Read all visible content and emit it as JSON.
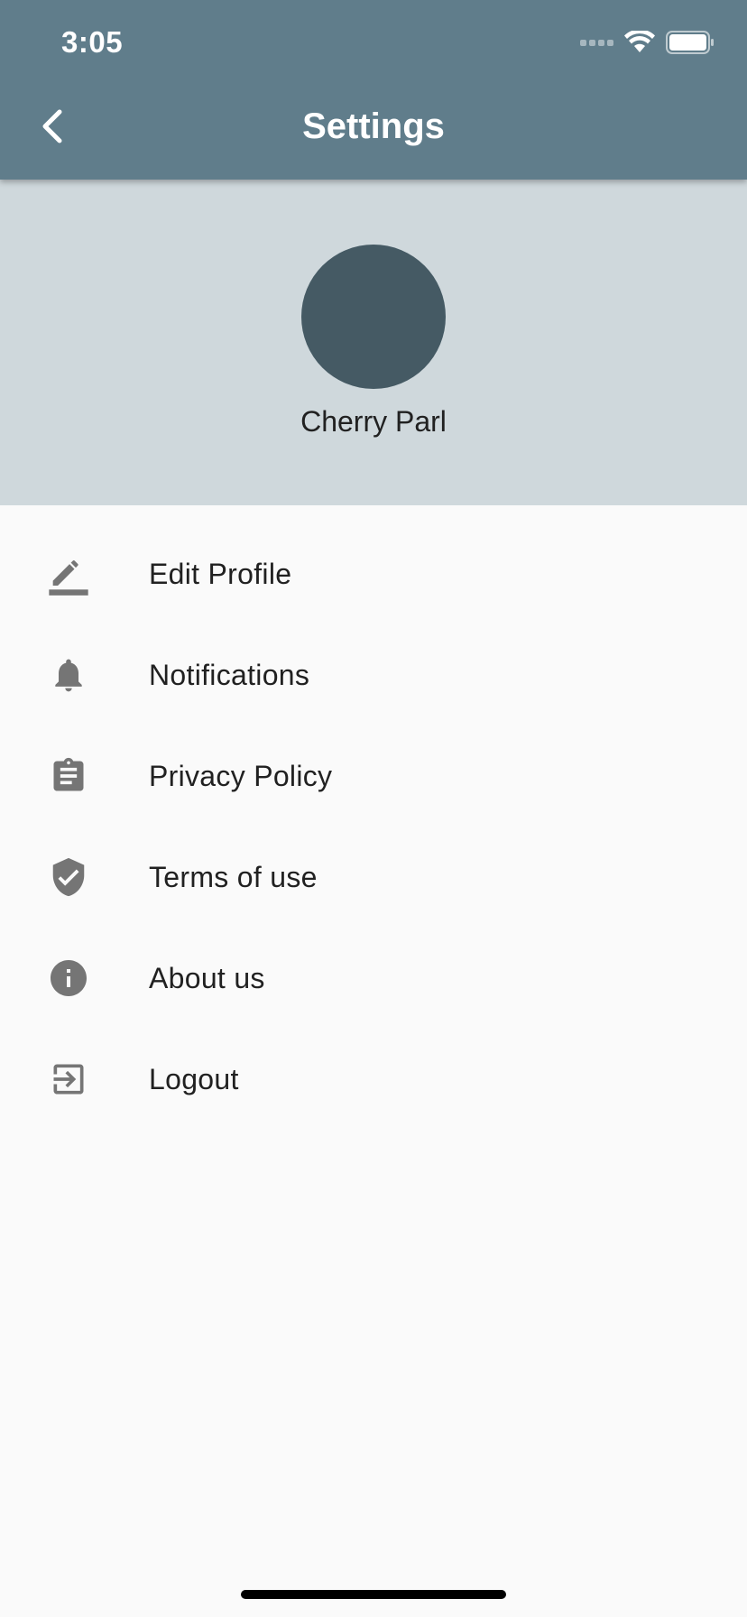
{
  "status_bar": {
    "time": "3:05"
  },
  "app_bar": {
    "title": "Settings",
    "background_color": "#607d8b"
  },
  "profile": {
    "name": "Cherry Parl",
    "header_color": "#cfd8dc",
    "avatar_color": "#455a64"
  },
  "menu": {
    "items": [
      {
        "label": "Edit Profile",
        "icon": "edit-pencil-icon"
      },
      {
        "label": "Notifications",
        "icon": "bell-icon"
      },
      {
        "label": "Privacy Policy",
        "icon": "clipboard-icon"
      },
      {
        "label": "Terms of use",
        "icon": "shield-check-icon"
      },
      {
        "label": "About us",
        "icon": "info-icon"
      },
      {
        "label": "Logout",
        "icon": "exit-icon"
      }
    ],
    "icon_color": "#757575"
  }
}
